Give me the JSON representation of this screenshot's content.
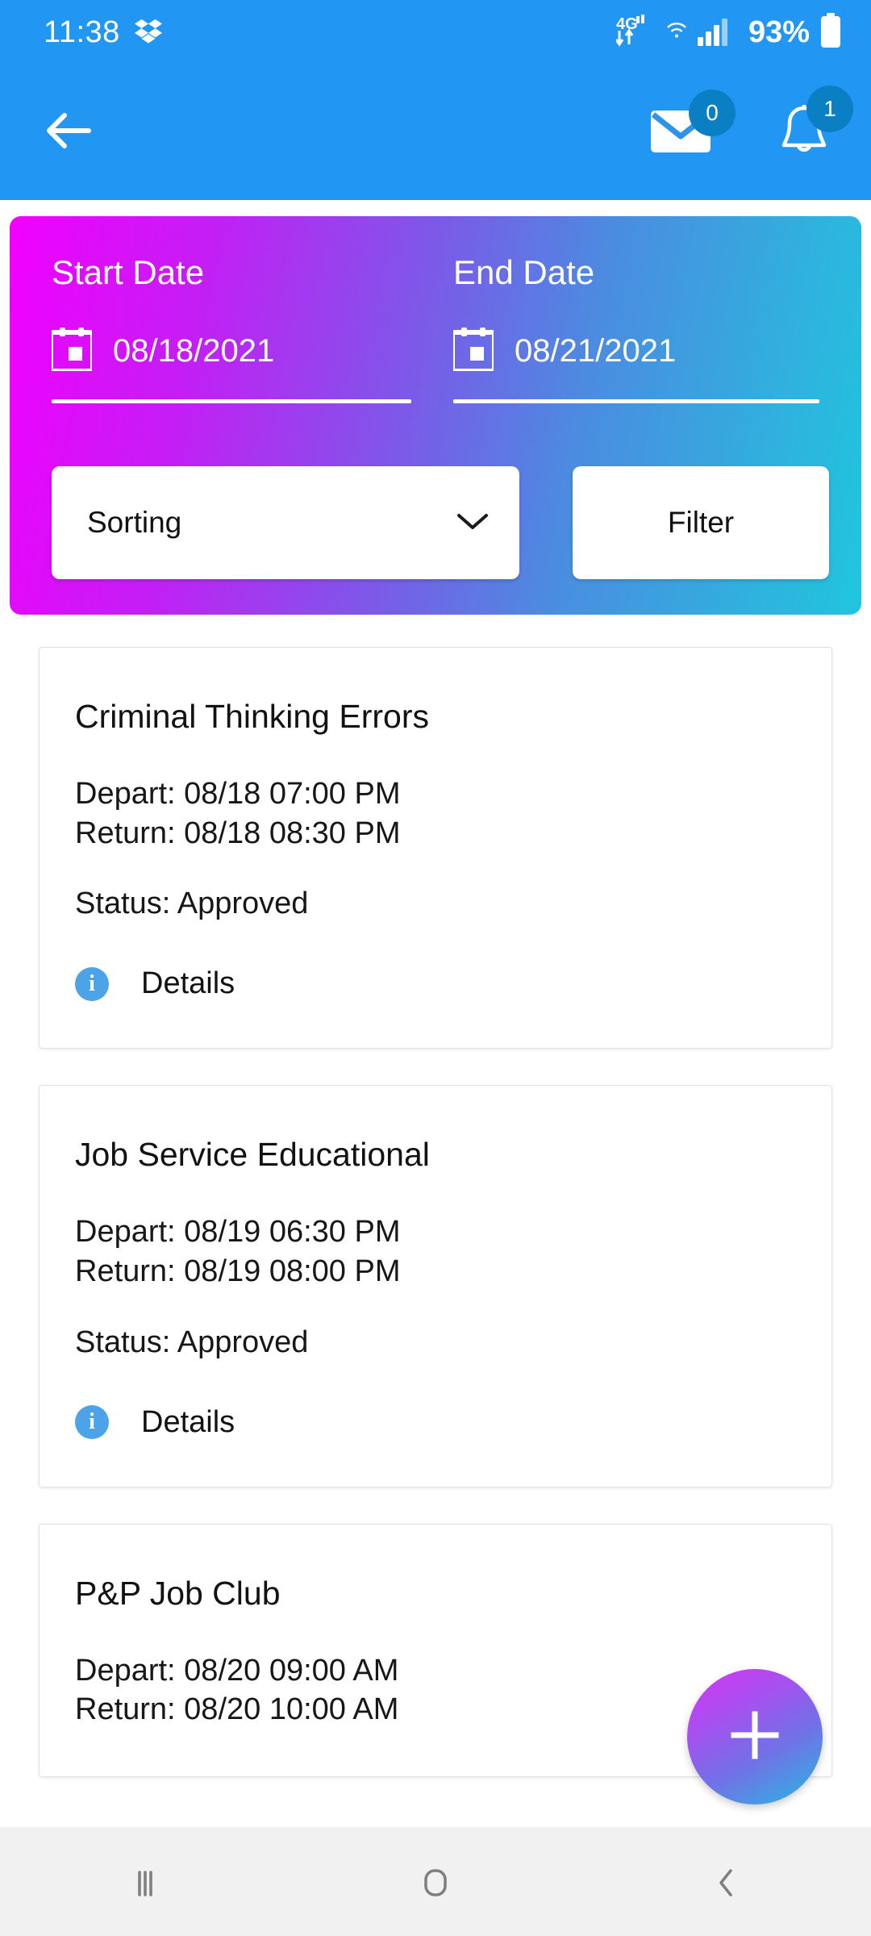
{
  "status_bar": {
    "time": "11:38",
    "cloud_icon": "dropbox-icon",
    "network_label": "4G",
    "battery_percent": "93%",
    "icons": [
      "dropbox-icon",
      "4g-lte-data-icon",
      "wifi-icon",
      "cellular-signal-icon",
      "battery-icon"
    ]
  },
  "app_bar": {
    "back_icon": "back-arrow-icon",
    "messages": {
      "icon": "envelope-icon",
      "badge": "0"
    },
    "notifications": {
      "icon": "bell-icon",
      "badge": "1"
    },
    "background_color": "#2196f3"
  },
  "filter_panel": {
    "gradient_from": "#f200ff",
    "gradient_to": "#20c6dd",
    "start_date": {
      "label": "Start Date",
      "value": "08/18/2021",
      "icon": "calendar-icon"
    },
    "end_date": {
      "label": "End Date",
      "value": "08/21/2021",
      "icon": "calendar-icon"
    },
    "sorting": {
      "label": "Sorting",
      "icon": "chevron-down-icon"
    },
    "filter_button": {
      "label": "Filter"
    }
  },
  "trips": [
    {
      "title": "Criminal Thinking Errors",
      "depart": "Depart: 08/18  07:00 PM",
      "return": "Return: 08/18  08:30 PM",
      "status": "Status: Approved",
      "details_label": "Details",
      "details_icon": "info-icon"
    },
    {
      "title": "Job Service Educational",
      "depart": "Depart: 08/19  06:30 PM",
      "return": "Return: 08/19  08:00 PM",
      "status": "Status: Approved",
      "details_label": "Details",
      "details_icon": "info-icon"
    },
    {
      "title": "P&P Job Club",
      "depart": "Depart: 08/20  09:00 AM",
      "return": "Return: 08/20  10:00 AM",
      "status": "",
      "details_label": "",
      "details_icon": "info-icon"
    }
  ],
  "fab": {
    "icon": "plus-icon",
    "gradient_from": "#d936f0",
    "gradient_to": "#26b9e0"
  },
  "nav_bar": {
    "recents_icon": "recents-icon",
    "home_icon": "home-icon",
    "back_icon": "back-chevron-icon",
    "background_color": "#f1f1f1"
  }
}
